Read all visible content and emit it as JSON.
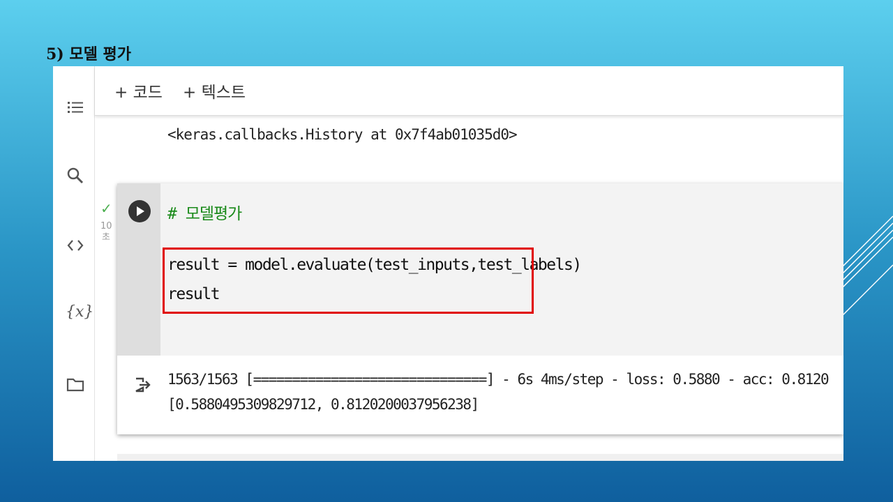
{
  "slide": {
    "title": "5) 모델 평가"
  },
  "sidebar": {
    "icons": [
      "table-of-contents-icon",
      "search-icon",
      "code-snippets-icon",
      "variables-icon",
      "files-icon"
    ],
    "variables_label": "{x}"
  },
  "toolbar": {
    "add_code_label": "+ 코드",
    "add_text_label": "+ 텍스트"
  },
  "previous_output": "<keras.callbacks.History at 0x7f4ab01035d0>",
  "cell": {
    "status_check": "✓",
    "exec_time": "10\n초",
    "comment": "# 모델평가",
    "code_lines": [
      "result = model.evaluate(test_inputs,test_labels)",
      "result"
    ],
    "output_lines": [
      "1563/1563 [==============================] - 6s 4ms/step - loss: 0.5880 - acc: 0.8120",
      "[0.5880495309829712, 0.8120200037956238]"
    ]
  },
  "colors": {
    "highlight": "#e00000",
    "comment": "#1a8a1a",
    "check": "#4caf50"
  }
}
